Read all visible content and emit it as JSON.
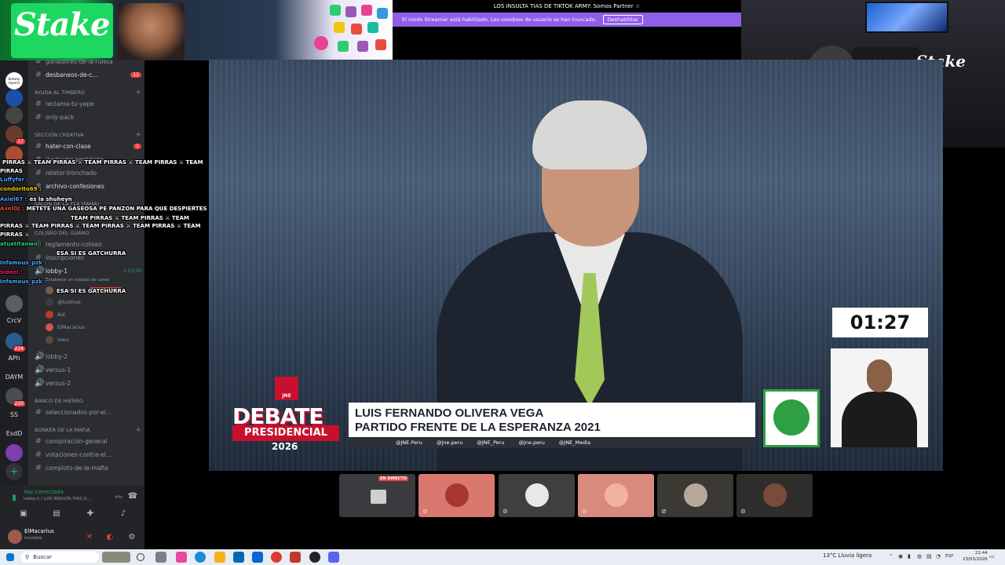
{
  "streamer_mode": {
    "top_text": "LOS INSULTA TIAS DE TIKTOK ARMY: Somos Partner ☆",
    "message": "El modo Streamer está habilitado. Los nombres de usuario se han truncado.",
    "button": "Deshabilitar"
  },
  "stake_banner": {
    "logo": "Stake",
    "cam_logo": "Stake"
  },
  "servers": [
    {
      "label": "",
      "badge": "26"
    },
    {
      "label": "betway esports",
      "badge": ""
    },
    {
      "label": "",
      "badge": ""
    },
    {
      "label": "",
      "badge": ""
    },
    {
      "label": "",
      "badge": "17"
    },
    {
      "label": "",
      "badge": ""
    },
    {
      "label": "CrcV",
      "badge": ""
    },
    {
      "label": "",
      "badge": "224"
    },
    {
      "label": "APh",
      "badge": ""
    },
    {
      "label": "DAYM",
      "badge": ""
    },
    {
      "label": "",
      "badge": "220"
    },
    {
      "label": "SS",
      "badge": ""
    },
    {
      "label": "EsdD",
      "badge": ""
    },
    {
      "label": "",
      "badge": ""
    }
  ],
  "channels": {
    "top_partial": "ganadores-de-la-ruleta",
    "c1": {
      "label": "desbaneos-de-c...",
      "badge": "11"
    },
    "cat_ayuda": "AYUDA AL TIMBERO",
    "c2": "reclama-tu-yape",
    "c3": "only-pack",
    "cat_seccion": "SECCIÓN CREATIVA",
    "c4": {
      "label": "hater-con-clase",
      "badge": "1"
    },
    "c5": "ilustrador-prohibido",
    "c6": "relator-tronchado",
    "c7": "archivo-confesiones",
    "cat_fama": "SALÓN DE LA FLA (FAMA)",
    "cat_coliseo": "COLISEO DEL GUANO",
    "c8": "reglamento-coliseo",
    "c9": "inscripciones",
    "voice_lobby": {
      "label": "lobby-1",
      "time": "1:53:30",
      "status": "Establece un estado de canal",
      "live": "EN DIRECTO"
    },
    "voice_users": [
      "@luishoe",
      "Asl.",
      "ElMacarius",
      "Uwu"
    ],
    "v2": "lobby-2",
    "v3": "versus-1",
    "v4": "versus-2",
    "cat_hierro": "BANCO DE HIERRO",
    "c10": "seleccionados-por-el...",
    "cat_bunker": "BÚNKER DE LA MAFIA",
    "c11": "conspiración-general",
    "c12": "votaciones-contra-el...",
    "c13": "complots-de-la-mafia"
  },
  "chat": [
    {
      "user": "",
      "text": "PIRRAS ⚔ TEAM PIRRAS ⚔ TEAM PIRRAS ⚔ TEAM PIRRAS ⚔ TEAM",
      "color": "#ffffff"
    },
    {
      "user": "",
      "text": "PIRRAS",
      "color": "#ffffff"
    },
    {
      "user": "Luffyfer :",
      "text": "",
      "color": "#4fa3ff"
    },
    {
      "user": "condorito69 :",
      "text": "",
      "color": "#f1c40f"
    },
    {
      "user": "Axiel67 :",
      "text": "es la shuheyn",
      "color": "#4fa3ff"
    },
    {
      "user": "AxelDJ :",
      "text": "METETE UNA GASEOSA PE PANZON PARA QUE DESPIERTES",
      "color": "#e74c3c"
    },
    {
      "user": "",
      "text": "TEAM PIRRAS ⚔ TEAM PIRRAS ⚔ TEAM",
      "color": "#ffffff"
    },
    {
      "user": "",
      "text": "PIRRAS ⚔ TEAM PIRRAS ⚔ TEAM PIRRAS ⚔ TEAM PIRRAS ⚔ TEAM",
      "color": "#ffffff"
    },
    {
      "user": "",
      "text": "PIRRAS ⚔",
      "color": "#ffffff"
    },
    {
      "user": "atuatitaowo :",
      "text": "",
      "color": "#2ecc71"
    },
    {
      "user": "",
      "text": "ESA SI ES GATCHURRA",
      "color": "#ffffff"
    },
    {
      "user": "Infamous_pzk :",
      "text": "",
      "color": "#4fa3ff"
    },
    {
      "user": "sideel :",
      "text": "",
      "color": "#e91e63"
    },
    {
      "user": "Infamous_pzk :",
      "text": "",
      "color": "#4fa3ff"
    },
    {
      "user": "",
      "text": "ESA SI ES GATCHURRA",
      "color": "#ffffff"
    }
  ],
  "voice_panel": {
    "status": "Voz conectada",
    "channel": "lobby-1 / LOS INSULTA TIAS D..."
  },
  "user_panel": {
    "name": "ElMacarius",
    "status": "Invisible"
  },
  "stream": {
    "timer": "01:27",
    "debate_word": "DEBATE",
    "presidencial": "PRESIDENCIAL",
    "year": "2026",
    "jne": "JNE",
    "candidate_name": "LUIS FERNANDO OLIVERA VEGA",
    "party": "PARTIDO FRENTE DE LA ESPERANZA 2021",
    "socials": [
      "@JNE.Peru",
      "@jne.peru",
      "@JNE_Peru",
      "@jne.peru",
      "@JNE_Media"
    ]
  },
  "tiles": [
    {
      "live": "EN DIRECTO",
      "color": "#3a3b3f"
    },
    {
      "live": "",
      "color": "#d9786e"
    },
    {
      "live": "",
      "color": "#3f3f42"
    },
    {
      "live": "",
      "color": "#d98a7e"
    },
    {
      "live": "",
      "color": "#3a3934"
    },
    {
      "live": "",
      "color": "#2f2e2c"
    }
  ],
  "taskbar": {
    "search": "Buscar",
    "weather": "13°C Lluvia ligera",
    "lang": "ESP",
    "time": "21:44",
    "date": "23/03/2026"
  }
}
